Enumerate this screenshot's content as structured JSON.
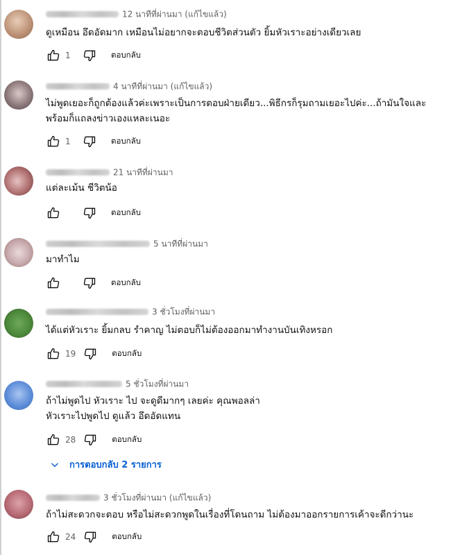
{
  "comments": [
    {
      "time": "12 นาทีที่ผ่านมา (แก้ไขแล้ว)",
      "text": [
        "ดูเหมือน อึดอัดมาก เหมือนไม่อยากจะตอบชีวิตส่วนตัว ยิ้มหัวเราะอย่างเดียวเลย"
      ],
      "likes": "1",
      "reply": "ตอบกลับ",
      "avatar_color": "#c9a98f"
    },
    {
      "time": "4 นาทีที่ผ่านมา (แก้ไขแล้ว)",
      "text": [
        "ไม่พูดเยอะก็ถูกต้องแล้วค่ะเพราะเป็นการตอบฝ่ายเดียว...พิธีกรก็รุมถามเยอะไปค่ะ...ถ้ามันใจและ",
        "พร้อมก็แถลงข่าวเองแหละเนอะ"
      ],
      "likes": "1",
      "reply": "ตอบกลับ",
      "avatar_color": "#8f7e80"
    },
    {
      "time": "21 นาทีที่ผ่านมา",
      "text": [
        "แต่ละเม้น ชีวิตน้อ"
      ],
      "likes": "",
      "reply": "ตอบกลับ",
      "avatar_color": "#b58585"
    },
    {
      "time": "5 นาทีที่ผ่านมา",
      "text": [
        "มาทำไม"
      ],
      "likes": "",
      "reply": "ตอบกลับ",
      "avatar_color": "#c7b1b3"
    },
    {
      "time": "3 ชั่วโมงที่ผ่านมา",
      "text": [
        "ได้แต่หัวเราะ ยิ้มกลบ รำคาญ ไม่ตอบก็ไม่ต้องออกมาทำงานบันเทิงหรอก"
      ],
      "likes": "19",
      "reply": "ตอบกลับ",
      "avatar_color": "#4e8a3c"
    },
    {
      "time": "5 ชั่วโมงที่ผ่านมา",
      "text": [
        "ถ้าไม่พูดไป หัวเราะ ไป จะดูดีมากๆ เลยค่ะ คุณพอลล่า",
        "หัวเราะไปพูดไป ดูแล้ว อึดอัดแทน"
      ],
      "likes": "28",
      "reply": "ตอบกลับ",
      "avatar_color": "#5f8fd9"
    },
    {
      "time": "3 ชั่วโมงที่ผ่านมา (แก้ไขแล้ว)",
      "text": [
        "ถ้าไม่สะดวกจะตอบ หรือไม่สะดวกพูดในเรื่องที่โดนถาม ไม่ต้องมาออกรายการเค้าจะดีกว่านะ"
      ],
      "likes": "24",
      "reply": "ตอบกลับ",
      "avatar_color": "#b86c76"
    }
  ],
  "replies_toggle": {
    "label": "การตอบกลับ 2 รายการ",
    "color": "#065fd4"
  },
  "icons": {
    "like": "thumbs-up-icon",
    "dislike": "thumbs-down-icon",
    "toggle": "chevron-down-icon"
  }
}
